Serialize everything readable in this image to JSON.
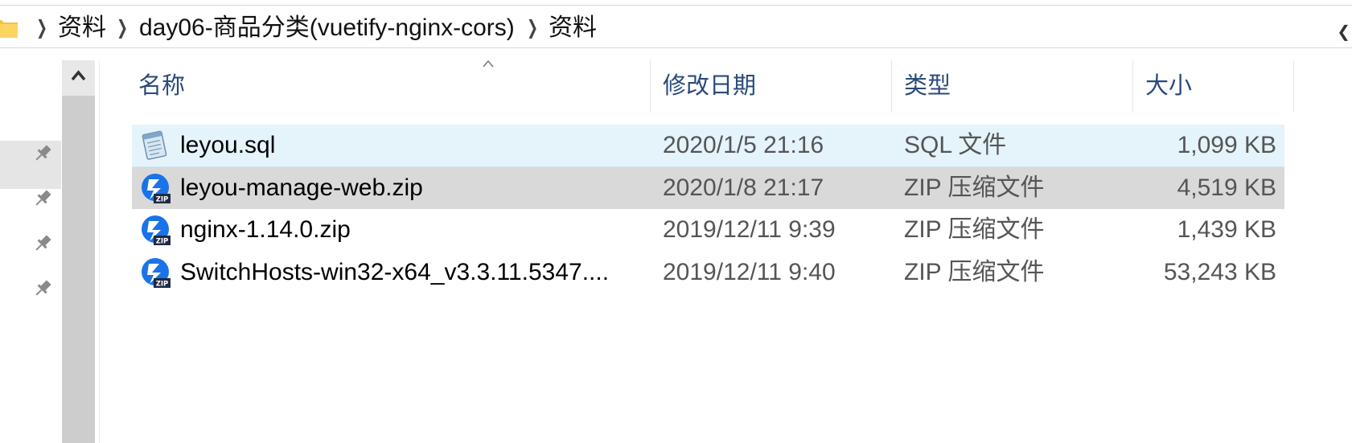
{
  "address_bar": {
    "crumbs": [
      "资料",
      "day06-商品分类(vuetify-nginx-cors)",
      "资料"
    ]
  },
  "columns": {
    "name": "名称",
    "modified": "修改日期",
    "type": "类型",
    "size": "大小"
  },
  "files": [
    {
      "name": "leyou.sql",
      "modified": "2020/1/5 21:16",
      "type": "SQL 文件",
      "size": "1,099 KB",
      "icon": "sql-file-icon"
    },
    {
      "name": "leyou-manage-web.zip",
      "modified": "2020/1/8 21:17",
      "type": "ZIP 压缩文件",
      "size": "4,519 KB",
      "icon": "zip-file-icon"
    },
    {
      "name": "nginx-1.14.0.zip",
      "modified": "2019/12/11 9:39",
      "type": "ZIP 压缩文件",
      "size": "1,439 KB",
      "icon": "zip-file-icon"
    },
    {
      "name": "SwitchHosts-win32-x64_v3.3.11.5347....",
      "modified": "2019/12/11 9:40",
      "type": "ZIP 压缩文件",
      "size": "53,243 KB",
      "icon": "zip-file-icon"
    }
  ],
  "zip_badge": "ZIP",
  "colors": {
    "header_text": "#2a4a7a",
    "row_hover": "#e5f3fb",
    "row_selected": "#d9d9d9",
    "zip_blue": "#1a73e8"
  }
}
